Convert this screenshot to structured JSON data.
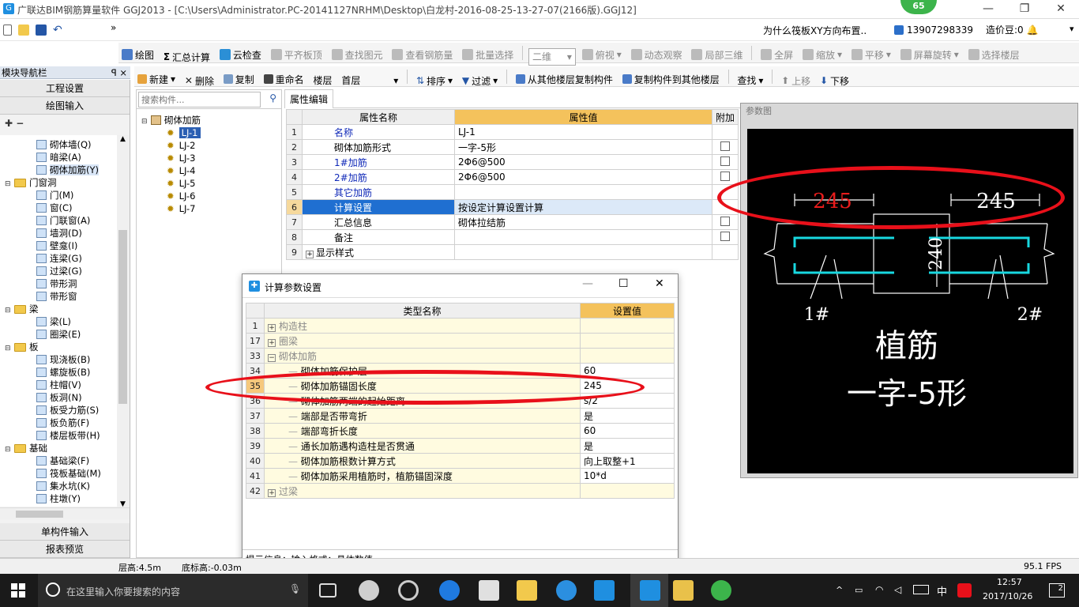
{
  "window": {
    "title": "广联达BIM钢筋算量软件 GGJ2013 - [C:\\Users\\Administrator.PC-20141127NRHM\\Desktop\\白龙村-2016-08-25-13-27-07(2166版).GGJ12]",
    "badge": "65",
    "controls": [
      "—",
      "❐",
      "✕"
    ]
  },
  "menubar": {
    "question": "为什么筏板XY方向布置..",
    "user": "13907298339",
    "price_label": "造价豆:0"
  },
  "toolbar1": {
    "items": [
      "绘图",
      "汇总计算",
      "云检查",
      "平齐板顶",
      "查找图元",
      "查看钢筋量",
      "批量选择",
      "二维",
      "俯视",
      "动态观察",
      "局部三维",
      "全屏",
      "缩放",
      "平移",
      "屏幕旋转",
      "选择楼层"
    ]
  },
  "toolbar2": {
    "items": [
      "新建",
      "删除",
      "复制",
      "重命名",
      "楼层",
      "首层",
      "排序",
      "过滤",
      "从其他楼层复制构件",
      "复制构件到其他楼层",
      "查找",
      "上移",
      "下移"
    ]
  },
  "leftnav": {
    "title": "模块导航栏",
    "pin": "ꟼ ×",
    "top_buttons": [
      "工程设置",
      "绘图输入"
    ],
    "tree": [
      {
        "type": "item",
        "label": "砌体墙(Q)"
      },
      {
        "type": "item",
        "label": "暗梁(A)"
      },
      {
        "type": "item",
        "label": "砌体加筋(Y)",
        "selected": true
      },
      {
        "type": "folder",
        "label": "门窗洞"
      },
      {
        "type": "item",
        "label": "门(M)"
      },
      {
        "type": "item",
        "label": "窗(C)"
      },
      {
        "type": "item",
        "label": "门联窗(A)"
      },
      {
        "type": "item",
        "label": "墙洞(D)"
      },
      {
        "type": "item",
        "label": "壁龛(I)"
      },
      {
        "type": "item",
        "label": "连梁(G)"
      },
      {
        "type": "item",
        "label": "过梁(G)"
      },
      {
        "type": "item",
        "label": "带形洞"
      },
      {
        "type": "item",
        "label": "带形窗"
      },
      {
        "type": "folder",
        "label": "梁"
      },
      {
        "type": "item",
        "label": "梁(L)"
      },
      {
        "type": "item",
        "label": "圈梁(E)"
      },
      {
        "type": "folder",
        "label": "板"
      },
      {
        "type": "item",
        "label": "现浇板(B)"
      },
      {
        "type": "item",
        "label": "螺旋板(B)"
      },
      {
        "type": "item",
        "label": "柱帽(V)"
      },
      {
        "type": "item",
        "label": "板洞(N)"
      },
      {
        "type": "item",
        "label": "板受力筋(S)"
      },
      {
        "type": "item",
        "label": "板负筋(F)"
      },
      {
        "type": "item",
        "label": "楼层板带(H)"
      },
      {
        "type": "folder",
        "label": "基础"
      },
      {
        "type": "item",
        "label": "基础梁(F)"
      },
      {
        "type": "item",
        "label": "筏板基础(M)"
      },
      {
        "type": "item",
        "label": "集水坑(K)"
      },
      {
        "type": "item",
        "label": "柱墩(Y)"
      }
    ],
    "bottom_buttons": [
      "单构件输入",
      "报表预览"
    ]
  },
  "complist": {
    "search_placeholder": "搜索构件...",
    "root": "砌体加筋",
    "items": [
      "LJ-1",
      "LJ-2",
      "LJ-3",
      "LJ-4",
      "LJ-5",
      "LJ-6",
      "LJ-7"
    ]
  },
  "props": {
    "tab": "属性编辑",
    "headers": [
      "属性名称",
      "属性值",
      "附加"
    ],
    "rows": [
      {
        "n": "1",
        "name": "名称",
        "value": "LJ-1",
        "blue": true,
        "cb": false
      },
      {
        "n": "2",
        "name": "砌体加筋形式",
        "value": "一字-5形",
        "blue": false,
        "cb": true
      },
      {
        "n": "3",
        "name": "1#加筋",
        "value": "2Φ6@500",
        "blue": true,
        "cb": true
      },
      {
        "n": "4",
        "name": "2#加筋",
        "value": "2Φ6@500",
        "blue": true,
        "cb": true
      },
      {
        "n": "5",
        "name": "其它加筋",
        "value": "",
        "blue": true,
        "cb": false
      },
      {
        "n": "6",
        "name": "计算设置",
        "value": "按设定计算设置计算",
        "blue": false,
        "cb": false,
        "selected": true
      },
      {
        "n": "7",
        "name": "汇总信息",
        "value": "砌体拉结筋",
        "blue": false,
        "cb": true
      },
      {
        "n": "8",
        "name": "备注",
        "value": "",
        "blue": false,
        "cb": true
      },
      {
        "n": "9",
        "name": "显示样式",
        "value": "",
        "blue": false,
        "cb": false,
        "expand": true
      }
    ]
  },
  "param": {
    "title": "参数图",
    "dim_left": "245",
    "dim_right": "245",
    "dim_vert": "240",
    "label1": "1#",
    "label2": "2#",
    "big1": "植筋",
    "big2": "一字-5形"
  },
  "dialog": {
    "title": "计算参数设置",
    "headers": [
      "类型名称",
      "设置值"
    ],
    "rows": [
      {
        "n": "1",
        "name": "构造柱",
        "value": "",
        "group": true,
        "sign": "+"
      },
      {
        "n": "17",
        "name": "圈梁",
        "value": "",
        "group": true,
        "sign": "+"
      },
      {
        "n": "33",
        "name": "砌体加筋",
        "value": "",
        "group": true,
        "sign": "−"
      },
      {
        "n": "34",
        "name": "砌体加筋保护层",
        "value": "60",
        "group": false
      },
      {
        "n": "35",
        "name": "砌体加筋锚固长度",
        "value": "245",
        "group": false,
        "selected": true
      },
      {
        "n": "36",
        "name": "砌体加筋两端的起始距离",
        "value": "s/2",
        "group": false
      },
      {
        "n": "37",
        "name": "端部是否带弯折",
        "value": "是",
        "group": false
      },
      {
        "n": "38",
        "name": "端部弯折长度",
        "value": "60",
        "group": false
      },
      {
        "n": "39",
        "name": "通长加筋遇构造柱是否贯通",
        "value": "是",
        "group": false
      },
      {
        "n": "40",
        "name": "砌体加筋根数计算方式",
        "value": "向上取整+1",
        "group": false
      },
      {
        "n": "41",
        "name": "砌体加筋采用植筋时，植筋锚固深度",
        "value": "10*d",
        "group": false
      },
      {
        "n": "42",
        "name": "过梁",
        "value": "",
        "group": true,
        "sign": "+"
      }
    ],
    "hint": "提示信息：输入格式：具体数值。"
  },
  "status": {
    "floor_height": "层高:4.5m",
    "base_height": "底标高:-0.03m",
    "fps": "95.1 FPS"
  },
  "taskbar": {
    "search_placeholder": "在这里输入你要搜索的内容",
    "time": "12:57",
    "date": "2017/10/26",
    "ime": "中",
    "notify": "2"
  }
}
